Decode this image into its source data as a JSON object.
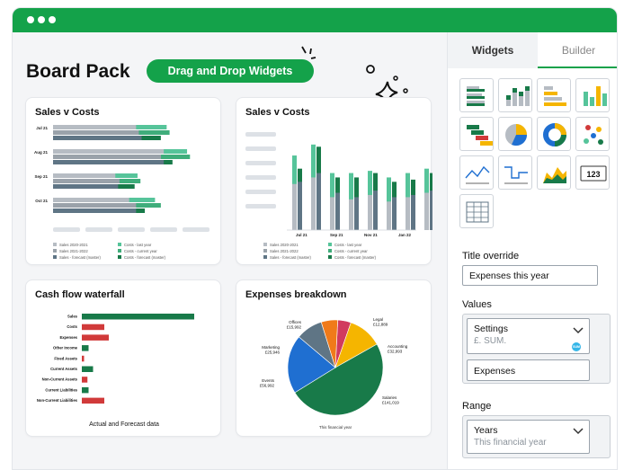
{
  "app": {
    "title": "Board Pack",
    "badge": "Drag and Drop Widgets"
  },
  "colors": {
    "accent": "#14a24a",
    "green_dark": "#187a49",
    "green_mid": "#3fad7b",
    "green_light": "#56c49a",
    "grey": "#b6bcc3",
    "slate": "#5f7585",
    "red": "#d13a3a",
    "blue": "#1f6fd1",
    "orange": "#f07a1a",
    "yellow": "#f5b500"
  },
  "sidebar": {
    "tabs": [
      {
        "label": "Widgets"
      },
      {
        "label": "Builder"
      }
    ],
    "widget_icons": [
      "grouped-bar-icon",
      "stacked-column-icon",
      "horizontal-bar-icon",
      "column-icon",
      "waterfall-icon",
      "pie-icon",
      "donut-icon",
      "scatter-icon",
      "line-icon",
      "step-line-icon",
      "area-icon",
      "number-icon",
      "table-icon"
    ],
    "number_widget_text": "123",
    "title_override": {
      "label": "Title override",
      "value": "Expenses this year"
    },
    "values": {
      "label": "Values",
      "select_title": "Settings",
      "select_sub": "£. SUM.",
      "select_badge": "SUM",
      "second": "Expenses"
    },
    "range": {
      "label": "Range",
      "select_title": "Years",
      "select_sub": "This financial year"
    }
  },
  "widgets": [
    {
      "title": "Sales v Costs",
      "chart_data": {
        "type": "bar",
        "orientation": "horizontal",
        "categories": [
          "Jul 21",
          "Aug 21",
          "Sep 21",
          "Oct 21"
        ],
        "series": [
          {
            "name": "Sales 2020-2021",
            "values": [
              60,
              80,
              45,
              55
            ]
          },
          {
            "name": "Sales 2021-2022",
            "values": [
              62,
              78,
              48,
              60
            ]
          },
          {
            "name": "Sales - forecast (master)",
            "values": [
              64,
              80,
              47,
              60
            ]
          },
          {
            "name": "Costs - last year",
            "values": [
              78,
              92,
              58,
              70
            ]
          },
          {
            "name": "Costs - current year",
            "values": [
              80,
              94,
              60,
              74
            ]
          },
          {
            "name": "Costs - forecast (master)",
            "values": [
              74,
              82,
              56,
              63
            ]
          }
        ],
        "legend": "bottom"
      }
    },
    {
      "title": "Sales v Costs",
      "chart_data": {
        "type": "bar",
        "orientation": "vertical",
        "categories": [
          "Jul 21",
          "Sep 21",
          "Nov 21",
          "Jan 22"
        ],
        "series": [
          {
            "name": "Sales 2020-2021",
            "values": [
              42,
              48,
              30,
              28,
              32,
              26,
              30,
              34
            ]
          },
          {
            "name": "Sales 2021-2022",
            "values": [
              40,
              50,
              32,
              30,
              34,
              28,
              32,
              32
            ]
          },
          {
            "name": "Sales - forecast (master)",
            "values": [
              44,
              52,
              34,
              30,
              36,
              30,
              32,
              36
            ]
          },
          {
            "name": "Costs - last year",
            "values": [
              66,
              72,
              50,
              50,
              52,
              46,
              50,
              56
            ]
          },
          {
            "name": "Costs - current year",
            "values": [
              68,
              78,
              52,
              52,
              54,
              48,
              52,
              56
            ]
          },
          {
            "name": "Costs - forecast (master)",
            "values": [
              56,
              76,
              48,
              48,
              52,
              44,
              46,
              52
            ]
          }
        ],
        "legend": "bottom"
      }
    },
    {
      "title": "Cash flow waterfall",
      "chart_data": {
        "type": "bar",
        "orientation": "horizontal",
        "categories": [
          "Sales",
          "Costs",
          "Expenses",
          "Other Income",
          "Fixed Assets",
          "Current Assets",
          "Non-Current Assets",
          "Current Liabilities",
          "Non-Current Liabilities"
        ],
        "values": [
          100,
          20,
          24,
          6,
          2,
          10,
          5,
          6,
          20
        ],
        "directions": [
          "up",
          "down",
          "down",
          "up",
          "down",
          "up",
          "down",
          "up",
          "down"
        ]
      },
      "footer": "Actual and Forecast data"
    },
    {
      "title": "Expenses breakdown",
      "chart_data": {
        "type": "pie",
        "labels": [
          "Legal",
          "Accounting",
          "Salaries",
          "Events",
          "Marketing",
          "Offices"
        ],
        "values": [
          12889,
          32993,
          141019,
          56992,
          25946,
          15992
        ],
        "value_labels": [
          "£12,889",
          "£32,993",
          "£141,019",
          "£56,992",
          "£25,946",
          "£15,992"
        ],
        "colors": [
          "#d13a5e",
          "#f5b500",
          "#187a49",
          "#1f6fd1",
          "#5f7585",
          "#f07a1a"
        ]
      },
      "footer": "This financial year"
    }
  ]
}
